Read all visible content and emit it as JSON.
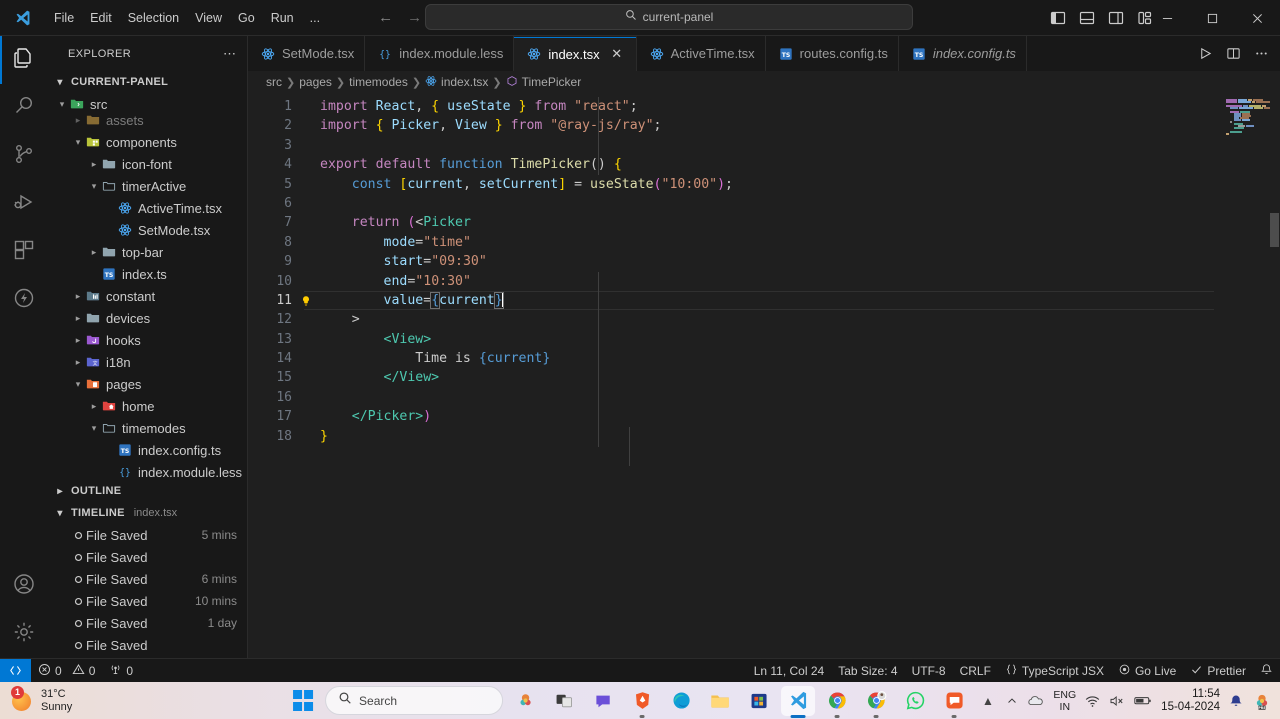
{
  "titlebar": {
    "logo_icon": "vscode-logo",
    "menu": [
      "File",
      "Edit",
      "Selection",
      "View",
      "Go",
      "Run",
      "..."
    ],
    "nav_back_icon": "arrow-left-icon",
    "nav_forward_icon": "arrow-right-icon",
    "search": {
      "icon": "search-icon",
      "value": "current-panel"
    },
    "layout_buttons": [
      {
        "name": "toggle-primary-sidebar",
        "icon": "layout-sidebar-left-icon"
      },
      {
        "name": "toggle-panel",
        "icon": "layout-panel-icon"
      },
      {
        "name": "toggle-secondary-sidebar",
        "icon": "layout-sidebar-right-icon"
      },
      {
        "name": "customize-layout",
        "icon": "layout-customize-icon"
      }
    ],
    "window_controls": [
      {
        "name": "minimize-button",
        "icon": "minimize-icon"
      },
      {
        "name": "maximize-button",
        "icon": "maximize-icon"
      },
      {
        "name": "close-button",
        "icon": "close-icon"
      }
    ]
  },
  "activitybar": {
    "items": [
      {
        "label": "Explorer",
        "icon": "files-icon",
        "active": true
      },
      {
        "label": "Search",
        "icon": "search-icon",
        "active": false
      },
      {
        "label": "Source Control",
        "icon": "source-control-icon",
        "active": false
      },
      {
        "label": "Run and Debug",
        "icon": "run-debug-icon",
        "active": false
      },
      {
        "label": "Extensions",
        "icon": "extensions-icon",
        "active": false
      },
      {
        "label": "Thunder Client",
        "icon": "thunder-icon",
        "active": false
      }
    ],
    "bottom": [
      {
        "label": "Accounts",
        "icon": "account-icon"
      },
      {
        "label": "Manage",
        "icon": "gear-icon"
      }
    ]
  },
  "sidebar": {
    "title": "EXPLORER",
    "more_actions_icon": "ellipsis-icon",
    "root": {
      "label": "CURRENT-PANEL",
      "expanded": true
    },
    "tree": [
      {
        "label": "src",
        "depth": 1,
        "type": "folder",
        "state": "expanded",
        "icon": "folder-src-icon",
        "sticky": true
      },
      {
        "label": "assets",
        "depth": 2,
        "type": "folder",
        "state": "collapsed",
        "icon": "folder-assets-icon",
        "clipped": true
      },
      {
        "label": "components",
        "depth": 2,
        "type": "folder",
        "state": "expanded",
        "icon": "folder-components-icon"
      },
      {
        "label": "icon-font",
        "depth": 3,
        "type": "folder",
        "state": "collapsed",
        "icon": "folder-icon"
      },
      {
        "label": "timerActive",
        "depth": 3,
        "type": "folder",
        "state": "expanded",
        "icon": "folder-open-icon"
      },
      {
        "label": "ActiveTime.tsx",
        "depth": 4,
        "type": "file",
        "state": "none",
        "icon": "react-icon"
      },
      {
        "label": "SetMode.tsx",
        "depth": 4,
        "type": "file",
        "state": "none",
        "icon": "react-icon"
      },
      {
        "label": "top-bar",
        "depth": 3,
        "type": "folder",
        "state": "collapsed",
        "icon": "folder-icon"
      },
      {
        "label": "index.ts",
        "depth": 3,
        "type": "file",
        "state": "none",
        "icon": "typescript-icon"
      },
      {
        "label": "constant",
        "depth": 2,
        "type": "folder",
        "state": "collapsed",
        "icon": "folder-constant-icon"
      },
      {
        "label": "devices",
        "depth": 2,
        "type": "folder",
        "state": "collapsed",
        "icon": "folder-icon"
      },
      {
        "label": "hooks",
        "depth": 2,
        "type": "folder",
        "state": "collapsed",
        "icon": "folder-hooks-icon"
      },
      {
        "label": "i18n",
        "depth": 2,
        "type": "folder",
        "state": "collapsed",
        "icon": "folder-i18n-icon"
      },
      {
        "label": "pages",
        "depth": 2,
        "type": "folder",
        "state": "expanded",
        "icon": "folder-pages-icon"
      },
      {
        "label": "home",
        "depth": 3,
        "type": "folder",
        "state": "collapsed",
        "icon": "folder-home-icon"
      },
      {
        "label": "timemodes",
        "depth": 3,
        "type": "folder",
        "state": "expanded",
        "icon": "folder-open-icon"
      },
      {
        "label": "index.config.ts",
        "depth": 4,
        "type": "file",
        "state": "none",
        "icon": "typescript-icon"
      },
      {
        "label": "index.module.less",
        "depth": 4,
        "type": "file",
        "state": "none",
        "icon": "less-icon"
      }
    ],
    "outline": {
      "label": "OUTLINE",
      "expanded": false
    },
    "timeline": {
      "label": "TIMELINE",
      "file": "index.tsx",
      "expanded": true,
      "items": [
        {
          "label": "File Saved",
          "time": "5 mins",
          "icon": "circle-outline-icon"
        },
        {
          "label": "File Saved",
          "time": "",
          "icon": "circle-outline-icon"
        },
        {
          "label": "File Saved",
          "time": "6 mins",
          "icon": "circle-outline-icon"
        },
        {
          "label": "File Saved",
          "time": "10 mins",
          "icon": "circle-outline-icon"
        },
        {
          "label": "File Saved",
          "time": "1 day",
          "icon": "circle-outline-icon"
        },
        {
          "label": "File Saved",
          "time": "",
          "icon": "circle-outline-icon"
        }
      ]
    }
  },
  "tabs": [
    {
      "label": "SetMode.tsx",
      "icon": "react-icon",
      "active": false,
      "preview": false,
      "closable": false
    },
    {
      "label": "index.module.less",
      "icon": "less-icon",
      "active": false,
      "preview": false,
      "closable": false
    },
    {
      "label": "index.tsx",
      "icon": "react-icon",
      "active": true,
      "preview": false,
      "closable": true,
      "close_icon": "close-icon"
    },
    {
      "label": "ActiveTime.tsx",
      "icon": "react-icon",
      "active": false,
      "preview": false,
      "closable": false
    },
    {
      "label": "routes.config.ts",
      "icon": "typescript-icon",
      "active": false,
      "preview": false,
      "closable": false
    },
    {
      "label": "index.config.ts",
      "icon": "typescript-icon",
      "active": false,
      "preview": true,
      "closable": false
    }
  ],
  "editor_actions": [
    {
      "name": "run-code-button",
      "icon": "play-icon"
    },
    {
      "name": "split-editor-button",
      "icon": "split-editor-icon"
    },
    {
      "name": "more-actions-button",
      "icon": "ellipsis-icon"
    }
  ],
  "breadcrumbs": [
    {
      "label": "src",
      "icon": ""
    },
    {
      "label": "pages",
      "icon": ""
    },
    {
      "label": "timemodes",
      "icon": ""
    },
    {
      "label": "index.tsx",
      "icon": "react-icon"
    },
    {
      "label": "TimePicker",
      "icon": "symbol-class-icon"
    }
  ],
  "code": {
    "lightbulb_line": 11,
    "current_line": 11,
    "lines": [
      {
        "n": 1,
        "tokens": [
          {
            "t": "import ",
            "c": "kw"
          },
          {
            "t": "React",
            "c": "ident"
          },
          {
            "t": ", ",
            "c": "punct"
          },
          {
            "t": "{",
            "c": "brace"
          },
          {
            "t": " useState ",
            "c": "ident"
          },
          {
            "t": "}",
            "c": "brace"
          },
          {
            "t": " from ",
            "c": "kw"
          },
          {
            "t": "\"react\"",
            "c": "str"
          },
          {
            "t": ";",
            "c": "punct"
          }
        ]
      },
      {
        "n": 2,
        "tokens": [
          {
            "t": "import ",
            "c": "kw"
          },
          {
            "t": "{",
            "c": "brace"
          },
          {
            "t": " Picker",
            "c": "ident"
          },
          {
            "t": ", ",
            "c": "punct"
          },
          {
            "t": "View ",
            "c": "ident"
          },
          {
            "t": "}",
            "c": "brace"
          },
          {
            "t": " from ",
            "c": "kw"
          },
          {
            "t": "\"@ray-js/ray\"",
            "c": "str"
          },
          {
            "t": ";",
            "c": "punct"
          }
        ]
      },
      {
        "n": 3,
        "tokens": []
      },
      {
        "n": 4,
        "tokens": [
          {
            "t": "export ",
            "c": "kw"
          },
          {
            "t": "default ",
            "c": "kw"
          },
          {
            "t": "function ",
            "c": "kw2"
          },
          {
            "t": "TimePicker",
            "c": "fn"
          },
          {
            "t": "()",
            "c": "punct"
          },
          {
            "t": " ",
            "c": "punct"
          },
          {
            "t": "{",
            "c": "brace"
          }
        ]
      },
      {
        "n": 5,
        "tokens": [
          {
            "t": "    ",
            "c": "punct"
          },
          {
            "t": "const ",
            "c": "kw2"
          },
          {
            "t": "[",
            "c": "brace"
          },
          {
            "t": "current",
            "c": "ident"
          },
          {
            "t": ", ",
            "c": "punct"
          },
          {
            "t": "setCurrent",
            "c": "ident"
          },
          {
            "t": "]",
            "c": "brace"
          },
          {
            "t": " = ",
            "c": "punct"
          },
          {
            "t": "useState",
            "c": "fn"
          },
          {
            "t": "(",
            "c": "paren"
          },
          {
            "t": "\"10:00\"",
            "c": "str"
          },
          {
            "t": ")",
            "c": "paren"
          },
          {
            "t": ";",
            "c": "punct"
          }
        ]
      },
      {
        "n": 6,
        "tokens": []
      },
      {
        "n": 7,
        "tokens": [
          {
            "t": "    ",
            "c": "punct"
          },
          {
            "t": "return ",
            "c": "kw"
          },
          {
            "t": "(",
            "c": "paren"
          },
          {
            "t": "<",
            "c": "punct"
          },
          {
            "t": "Picker",
            "c": "tag"
          }
        ]
      },
      {
        "n": 8,
        "tokens": [
          {
            "t": "        ",
            "c": "punct"
          },
          {
            "t": "mode",
            "c": "attr"
          },
          {
            "t": "=",
            "c": "punct"
          },
          {
            "t": "\"time\"",
            "c": "str"
          }
        ]
      },
      {
        "n": 9,
        "tokens": [
          {
            "t": "        ",
            "c": "punct"
          },
          {
            "t": "start",
            "c": "attr"
          },
          {
            "t": "=",
            "c": "punct"
          },
          {
            "t": "\"09:30\"",
            "c": "str"
          }
        ]
      },
      {
        "n": 10,
        "tokens": [
          {
            "t": "        ",
            "c": "punct"
          },
          {
            "t": "end",
            "c": "attr"
          },
          {
            "t": "=",
            "c": "punct"
          },
          {
            "t": "\"10:30\"",
            "c": "str"
          }
        ]
      },
      {
        "n": 11,
        "tokens": [
          {
            "t": "        ",
            "c": "punct"
          },
          {
            "t": "value",
            "c": "attr"
          },
          {
            "t": "=",
            "c": "punct"
          },
          {
            "t": "{",
            "c": "brkt"
          },
          {
            "t": "current",
            "c": "ident"
          },
          {
            "t": "}",
            "c": "brkt"
          }
        ]
      },
      {
        "n": 12,
        "tokens": [
          {
            "t": "    ",
            "c": "punct"
          },
          {
            "t": ">",
            "c": "punct"
          }
        ]
      },
      {
        "n": 13,
        "tokens": [
          {
            "t": "        ",
            "c": "punct"
          },
          {
            "t": "<View>",
            "c": "tag"
          }
        ]
      },
      {
        "n": 14,
        "tokens": [
          {
            "t": "            ",
            "c": "punct"
          },
          {
            "t": "Time is ",
            "c": "txt"
          },
          {
            "t": "{current}",
            "c": "kw2"
          }
        ]
      },
      {
        "n": 15,
        "tokens": [
          {
            "t": "        ",
            "c": "punct"
          },
          {
            "t": "</View>",
            "c": "tag"
          }
        ]
      },
      {
        "n": 16,
        "tokens": []
      },
      {
        "n": 17,
        "tokens": [
          {
            "t": "    ",
            "c": "punct"
          },
          {
            "t": "</Picker>",
            "c": "tag"
          },
          {
            "t": ")",
            "c": "paren"
          }
        ]
      },
      {
        "n": 18,
        "tokens": [
          {
            "t": "}",
            "c": "brace"
          }
        ]
      }
    ]
  },
  "statusbar": {
    "remote": {
      "icon": "remote-icon",
      "label": ""
    },
    "left": [
      {
        "name": "problems-errors",
        "icon": "error-icon",
        "label": "0"
      },
      {
        "name": "problems-warnings",
        "icon": "warning-icon",
        "label": "0"
      },
      {
        "name": "ports",
        "icon": "radio-tower-icon",
        "label": "0"
      }
    ],
    "right": [
      {
        "name": "editor-position",
        "icon": "",
        "label": "Ln 11, Col 24"
      },
      {
        "name": "editor-indentation",
        "icon": "",
        "label": "Tab Size: 4"
      },
      {
        "name": "editor-encoding",
        "icon": "",
        "label": "UTF-8"
      },
      {
        "name": "editor-eol",
        "icon": "",
        "label": "CRLF"
      },
      {
        "name": "editor-language",
        "icon": "braces-icon",
        "label": "TypeScript JSX"
      },
      {
        "name": "go-live",
        "icon": "broadcast-icon",
        "label": "Go Live"
      },
      {
        "name": "prettier",
        "icon": "check-icon",
        "label": "Prettier"
      },
      {
        "name": "notifications",
        "icon": "bell-icon",
        "label": ""
      }
    ]
  },
  "taskbar": {
    "weather": {
      "temperature": "31°C",
      "condition": "Sunny",
      "badge": "1",
      "icon": "sun-icon"
    },
    "start": {
      "icon": "windows-logo-icon"
    },
    "search": {
      "icon": "search-icon",
      "placeholder": "Search"
    },
    "apps": [
      {
        "name": "copilot-icon",
        "active": false,
        "running": false
      },
      {
        "name": "task-view-icon",
        "active": false,
        "running": false
      },
      {
        "name": "chat-icon",
        "active": false,
        "running": false
      },
      {
        "name": "brave-icon",
        "active": false,
        "running": true
      },
      {
        "name": "brave-2-icon",
        "active": false,
        "running": true
      },
      {
        "name": "edge-icon",
        "active": false,
        "running": false
      },
      {
        "name": "file-explorer-icon",
        "active": false,
        "running": false
      },
      {
        "name": "microsoft-store-icon",
        "active": false,
        "running": false
      },
      {
        "name": "vscode-icon",
        "active": true,
        "running": true
      },
      {
        "name": "chrome-icon",
        "active": false,
        "running": true
      },
      {
        "name": "chrome-profile-icon",
        "active": false,
        "running": true
      },
      {
        "name": "whatsapp-icon",
        "active": false,
        "running": false
      },
      {
        "name": "chat-app-icon",
        "active": false,
        "running": true
      }
    ],
    "tray_chevron_icon": "chevron-up-icon",
    "tray": {
      "onedrive_icon": "cloud-icon",
      "language": {
        "line1": "ENG",
        "line2": "IN"
      },
      "wifi_icon": "wifi-icon",
      "volume_icon": "volume-mute-icon",
      "battery_icon": "battery-icon",
      "time": "11:54",
      "date": "15-04-2024",
      "bell_icon": "bell-icon",
      "copilot_icon": "copilot-pre-icon"
    }
  },
  "colors": {
    "accent": "#0078d4",
    "editor_bg": "#1f1f1f",
    "chrome_bg": "#181818"
  }
}
